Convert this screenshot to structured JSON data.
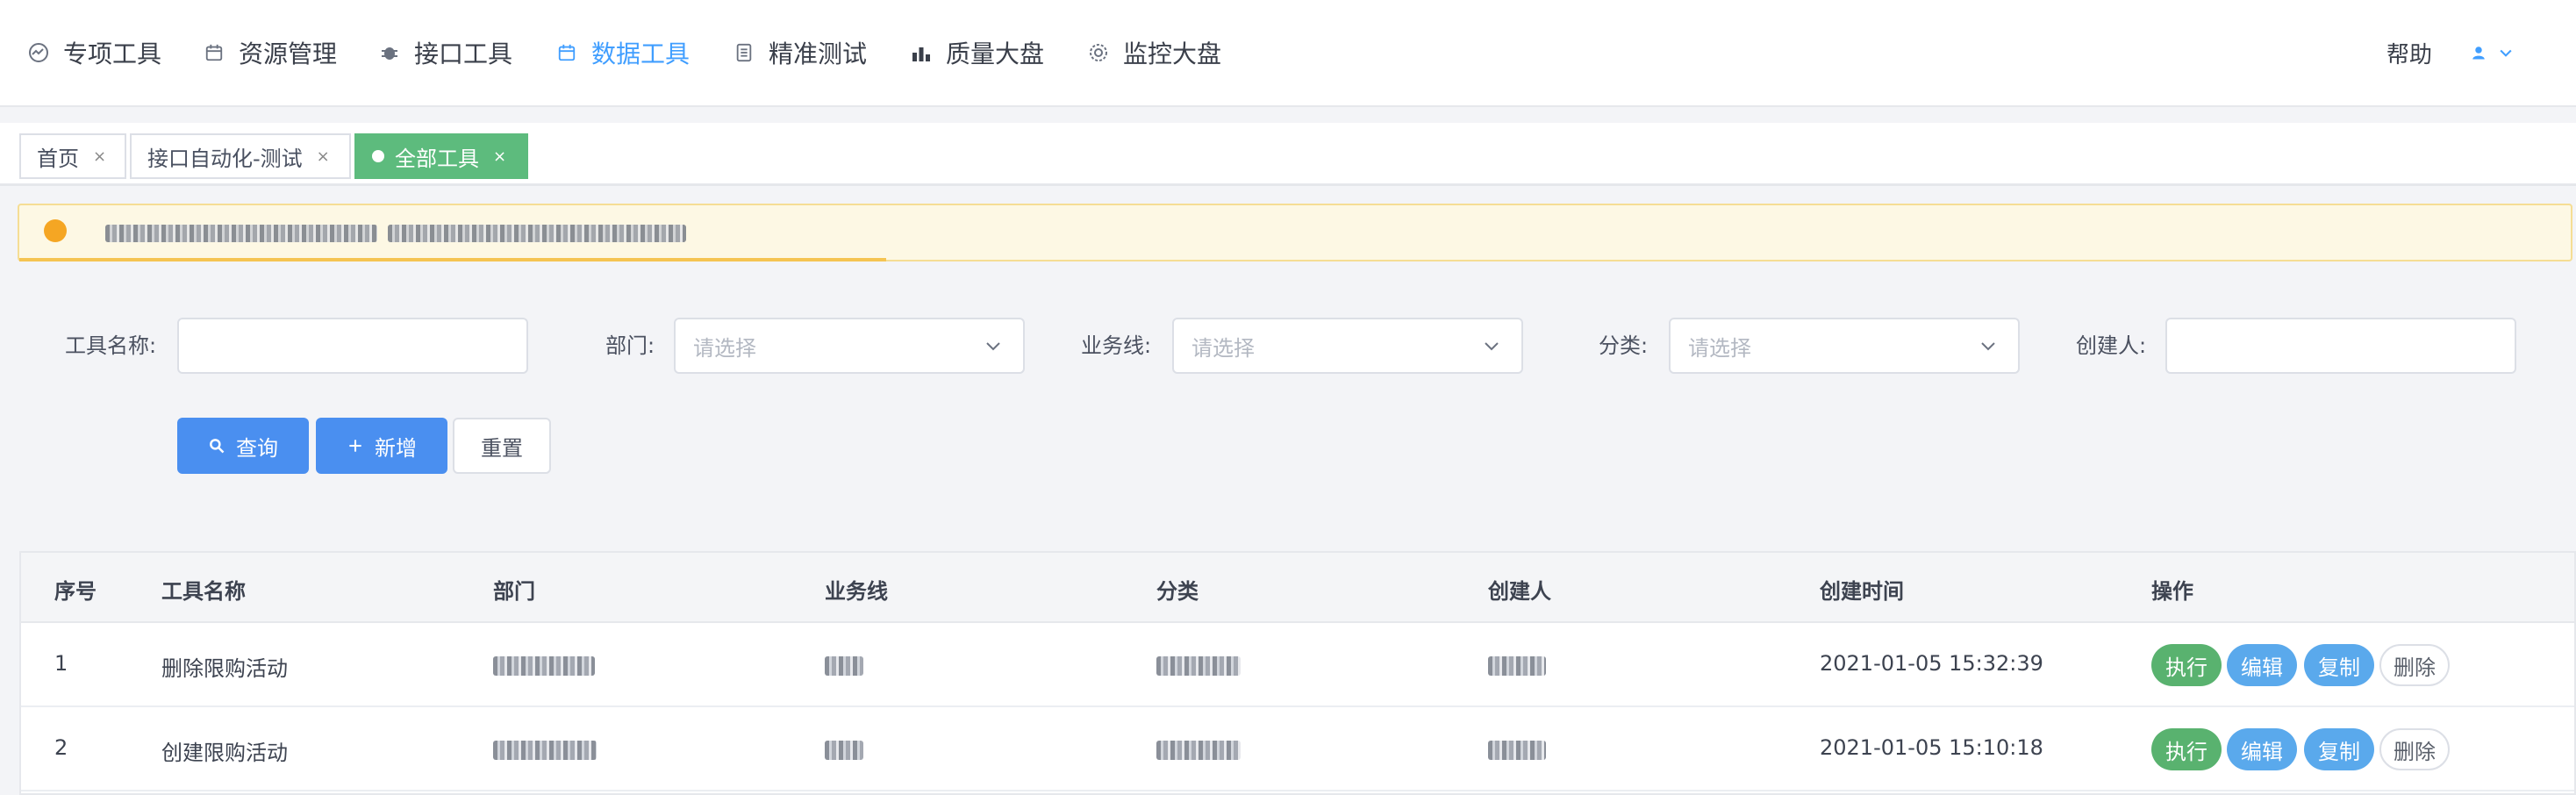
{
  "nav": {
    "items": [
      {
        "label": "专项工具",
        "icon": "gauge-icon"
      },
      {
        "label": "资源管理",
        "icon": "calendar-icon"
      },
      {
        "label": "接口工具",
        "icon": "bug-icon"
      },
      {
        "label": "数据工具",
        "icon": "calendar-icon"
      },
      {
        "label": "精准测试",
        "icon": "document-icon"
      },
      {
        "label": "质量大盘",
        "icon": "bar-chart-icon"
      },
      {
        "label": "监控大盘",
        "icon": "gear-icon"
      }
    ],
    "active": "数据工具",
    "help": "帮助",
    "user_icon": "user-icon"
  },
  "tabs": [
    {
      "label": "首页",
      "active": false
    },
    {
      "label": "接口自动化-测试",
      "active": false
    },
    {
      "label": "全部工具",
      "active": true
    }
  ],
  "filters": {
    "tool_name_label": "工具名称:",
    "department_label": "部门:",
    "department_placeholder": "请选择",
    "business_line_label": "业务线:",
    "business_line_placeholder": "请选择",
    "category_label": "分类:",
    "category_placeholder": "请选择",
    "creator_label": "创建人:"
  },
  "buttons": {
    "query": "查询",
    "add": "新增",
    "reset": "重置"
  },
  "table": {
    "columns": [
      "序号",
      "工具名称",
      "部门",
      "业务线",
      "分类",
      "创建人",
      "创建时间",
      "操作"
    ],
    "rows": [
      {
        "index": "1",
        "name": "删除限购活动",
        "created_at": "2021-01-05 15:32:39"
      },
      {
        "index": "2",
        "name": "创建限购活动",
        "created_at": "2021-01-05 15:10:18"
      }
    ],
    "actions": {
      "run": "执行",
      "edit": "编辑",
      "copy": "复制",
      "delete": "删除"
    }
  },
  "colors": {
    "primary": "#4a8ff0",
    "active_tab": "#5dbb7d",
    "notice_bg": "#fdf8e4",
    "action_green": "#59b26f",
    "action_blue": "#5aa9ec"
  }
}
